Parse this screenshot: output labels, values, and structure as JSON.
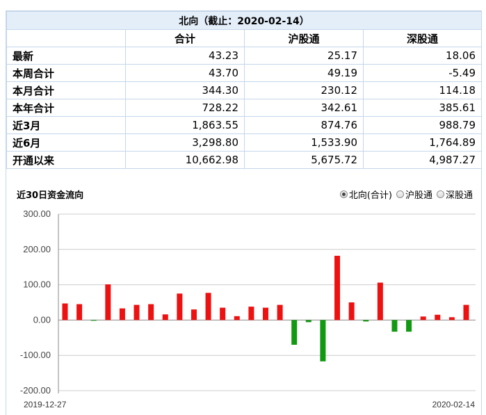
{
  "table": {
    "title": "北向（截止：2020-02-14）",
    "columns": [
      "合计",
      "沪股通",
      "深股通"
    ],
    "rows": [
      {
        "label": "最新",
        "total": "43.23",
        "sh": "25.17",
        "sz": "18.06"
      },
      {
        "label": "本周合计",
        "total": "43.70",
        "sh": "49.19",
        "sz": "-5.49"
      },
      {
        "label": "本月合计",
        "total": "344.30",
        "sh": "230.12",
        "sz": "114.18"
      },
      {
        "label": "本年合计",
        "total": "728.22",
        "sh": "342.61",
        "sz": "385.61"
      },
      {
        "label": "近3月",
        "total": "1,863.55",
        "sh": "874.76",
        "sz": "988.79"
      },
      {
        "label": "近6月",
        "total": "3,298.80",
        "sh": "1,533.90",
        "sz": "1,764.89"
      },
      {
        "label": "开通以来",
        "total": "10,662.98",
        "sh": "5,675.72",
        "sz": "4,987.27"
      }
    ]
  },
  "chart_section": {
    "title": "近30日资金流向",
    "legend": [
      {
        "label": "北向(合计)",
        "selected": true
      },
      {
        "label": "沪股通",
        "selected": false
      },
      {
        "label": "深股通",
        "selected": false
      }
    ]
  },
  "chart_data": {
    "type": "bar",
    "ylim": [
      -200,
      300
    ],
    "yticks": [
      "300.00",
      "200.00",
      "100.00",
      "0.00",
      "-100.00",
      "-200.00"
    ],
    "x_start_label": "2019-12-27",
    "x_end_label": "2020-02-14",
    "values": [
      47,
      45,
      -2,
      101,
      33,
      43,
      45,
      16,
      75,
      30,
      77,
      35,
      11,
      38,
      35,
      43,
      -70,
      -6,
      -117,
      182,
      50,
      -4,
      106,
      -33,
      -33,
      10,
      15,
      8,
      43
    ],
    "positive_color": "#ee1111",
    "negative_color": "#119911",
    "grid": true
  }
}
